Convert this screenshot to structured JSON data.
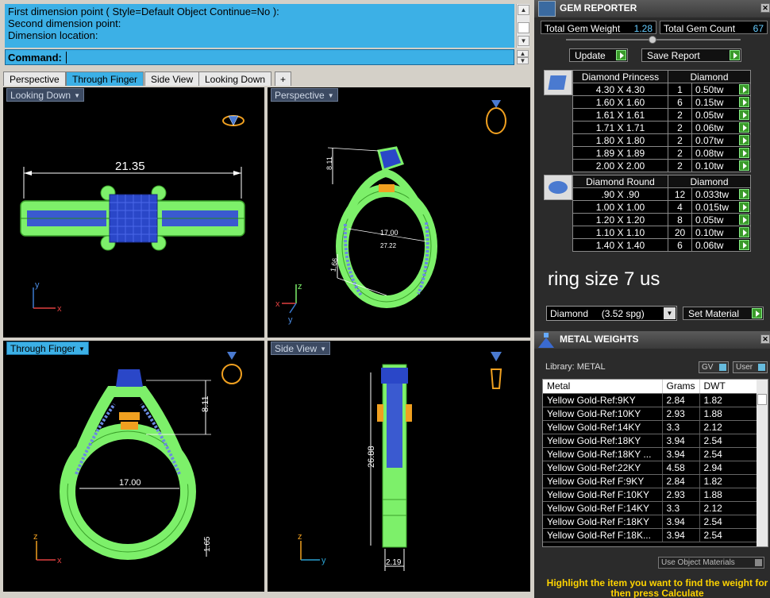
{
  "command": {
    "history": [
      "First dimension point ( Style=Default  Object  Continue=No ):",
      "Second dimension point:",
      "Dimension location:"
    ],
    "prompt": "Command:"
  },
  "tabs": [
    "Perspective",
    "Through Finger",
    "Side View",
    "Looking Down",
    "+"
  ],
  "active_tab": 1,
  "viewports": {
    "top_left": {
      "label": "Looking Down",
      "dimension": "21.35",
      "axis_x": "x",
      "axis_y": "y"
    },
    "top_right": {
      "label": "Perspective",
      "dim_a": "8.11",
      "dim_b": "17.00",
      "dim_c": "1.66",
      "dim_d": "27.22",
      "axis_x": "x",
      "axis_y": "y",
      "axis_z": "z"
    },
    "bottom_left": {
      "label": "Through Finger",
      "dim_height": "8.11",
      "dim_width": "17.00",
      "dim_band": "1.65",
      "axis_x": "x",
      "axis_z": "z"
    },
    "bottom_right": {
      "label": "Side View",
      "dim_height": "26.88",
      "dim_width": "2.19",
      "axis_y": "y",
      "axis_z": "z"
    }
  },
  "gem_reporter": {
    "title": "GEM REPORTER",
    "total_weight_label": "Total Gem Weight",
    "total_weight": "1.28",
    "total_count_label": "Total Gem Count",
    "total_count": "67",
    "update_label": "Update",
    "save_label": "Save Report",
    "princess": {
      "header_name": "Diamond Princess",
      "header_material": "Diamond",
      "rows": [
        {
          "size": "4.30 X 4.30",
          "count": "1",
          "weight": "0.50tw"
        },
        {
          "size": "1.60 X 1.60",
          "count": "6",
          "weight": "0.15tw"
        },
        {
          "size": "1.61 X 1.61",
          "count": "2",
          "weight": "0.05tw"
        },
        {
          "size": "1.71 X 1.71",
          "count": "2",
          "weight": "0.06tw"
        },
        {
          "size": "1.80 X 1.80",
          "count": "2",
          "weight": "0.07tw"
        },
        {
          "size": "1.89 X 1.89",
          "count": "2",
          "weight": "0.08tw"
        },
        {
          "size": "2.00 X 2.00",
          "count": "2",
          "weight": "0.10tw"
        }
      ]
    },
    "round": {
      "header_name": "Diamond Round",
      "header_material": "Diamond",
      "rows": [
        {
          "size": ".90 X .90",
          "count": "12",
          "weight": "0.033tw"
        },
        {
          "size": "1.00 X 1.00",
          "count": "4",
          "weight": "0.015tw"
        },
        {
          "size": "1.20 X 1.20",
          "count": "8",
          "weight": "0.05tw"
        },
        {
          "size": "1.10 X 1.10",
          "count": "20",
          "weight": "0.10tw"
        },
        {
          "size": "1.40 X 1.40",
          "count": "6",
          "weight": "0.06tw"
        }
      ]
    },
    "ring_size": "ring size 7 us",
    "material_select": "Diamond     (3.52 spg)",
    "set_material_label": "Set Material"
  },
  "metal_weights": {
    "title": "METAL WEIGHTS",
    "library_label": "Library: METAL",
    "gv_label": "GV",
    "user_label": "User",
    "columns": [
      "Metal",
      "Grams",
      "DWT"
    ],
    "rows": [
      [
        "Yellow Gold-Ref:9KY",
        "2.84",
        "1.82"
      ],
      [
        "Yellow Gold-Ref:10KY",
        "2.93",
        "1.88"
      ],
      [
        "Yellow Gold-Ref:14KY",
        "3.3",
        "2.12"
      ],
      [
        "Yellow Gold-Ref:18KY",
        "3.94",
        "2.54"
      ],
      [
        "Yellow Gold-Ref:18KY ...",
        "3.94",
        "2.54"
      ],
      [
        "Yellow Gold-Ref:22KY",
        "4.58",
        "2.94"
      ],
      [
        "Yellow Gold-Ref F:9KY",
        "2.84",
        "1.82"
      ],
      [
        "Yellow Gold-Ref F:10KY",
        "2.93",
        "1.88"
      ],
      [
        "Yellow Gold-Ref F:14KY",
        "3.3",
        "2.12"
      ],
      [
        "Yellow Gold-Ref F:18KY",
        "3.94",
        "2.54"
      ],
      [
        "Yellow Gold-Ref F:18K...",
        "3.94",
        "2.54"
      ]
    ],
    "use_object_materials": "Use Object Materials",
    "hint": "Highlight the item you want to find the weight for then press Calculate"
  }
}
